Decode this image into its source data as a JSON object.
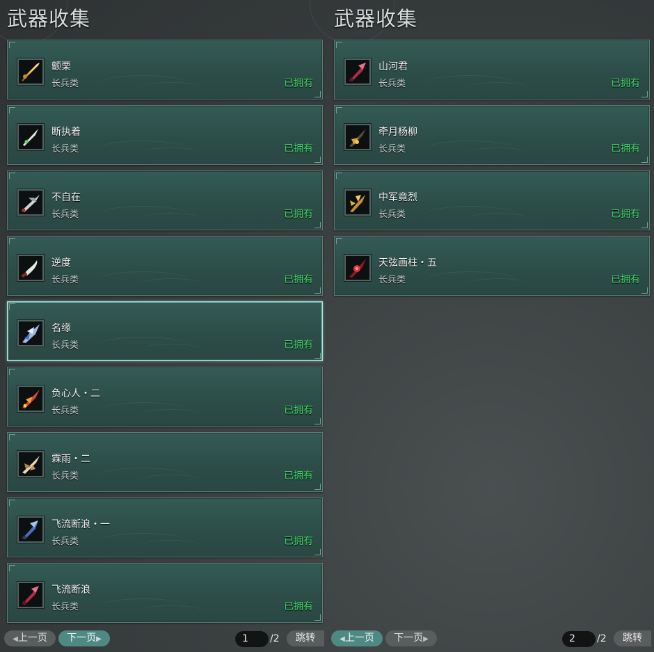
{
  "left": {
    "title": "武器收集",
    "items": [
      {
        "name": "颤栗",
        "type": "长兵类",
        "status": "已拥有",
        "icon": "golden-spear-icon"
      },
      {
        "name": "断执着",
        "type": "长兵类",
        "status": "已拥有",
        "icon": "white-green-spear-icon"
      },
      {
        "name": "不自在",
        "type": "长兵类",
        "status": "已拥有",
        "icon": "silver-halberd-icon"
      },
      {
        "name": "逆度",
        "type": "长兵类",
        "status": "已拥有",
        "icon": "curved-blade-icon"
      },
      {
        "name": "名缘",
        "type": "长兵类",
        "status": "已拥有",
        "icon": "blue-crystal-spear-icon"
      },
      {
        "name": "负心人・二",
        "type": "长兵类",
        "status": "已拥有",
        "icon": "red-fire-spear-icon"
      },
      {
        "name": "霖雨・二",
        "type": "长兵类",
        "status": "已拥有",
        "icon": "bone-spear-icon"
      },
      {
        "name": "飞流断浪・一",
        "type": "长兵类",
        "status": "已拥有",
        "icon": "blue-spear-icon"
      },
      {
        "name": "飞流断浪",
        "type": "长兵类",
        "status": "已拥有",
        "icon": "crimson-spear-icon"
      }
    ],
    "pager": {
      "prev": "上一页",
      "next": "下一页",
      "page": "1",
      "total": "/2",
      "jump": "跳转"
    }
  },
  "right": {
    "title": "武器收集",
    "items": [
      {
        "name": "山河君",
        "type": "长兵类",
        "status": "已拥有",
        "icon": "crimson-spear-icon"
      },
      {
        "name": "牵月杨柳",
        "type": "长兵类",
        "status": "已拥有",
        "icon": "dark-gold-spear-icon"
      },
      {
        "name": "中军竟烈",
        "type": "长兵类",
        "status": "已拥有",
        "icon": "gold-trident-icon"
      },
      {
        "name": "天弦画柱・五",
        "type": "长兵类",
        "status": "已拥有",
        "icon": "red-gem-spear-icon"
      }
    ],
    "pager": {
      "prev": "上一页",
      "next": "下一页",
      "page": "2",
      "total": "/2",
      "jump": "跳转"
    }
  },
  "colors": {
    "owned": "#3fd36a",
    "card": "#2f514c",
    "selected_border": "#a8e6dc"
  }
}
